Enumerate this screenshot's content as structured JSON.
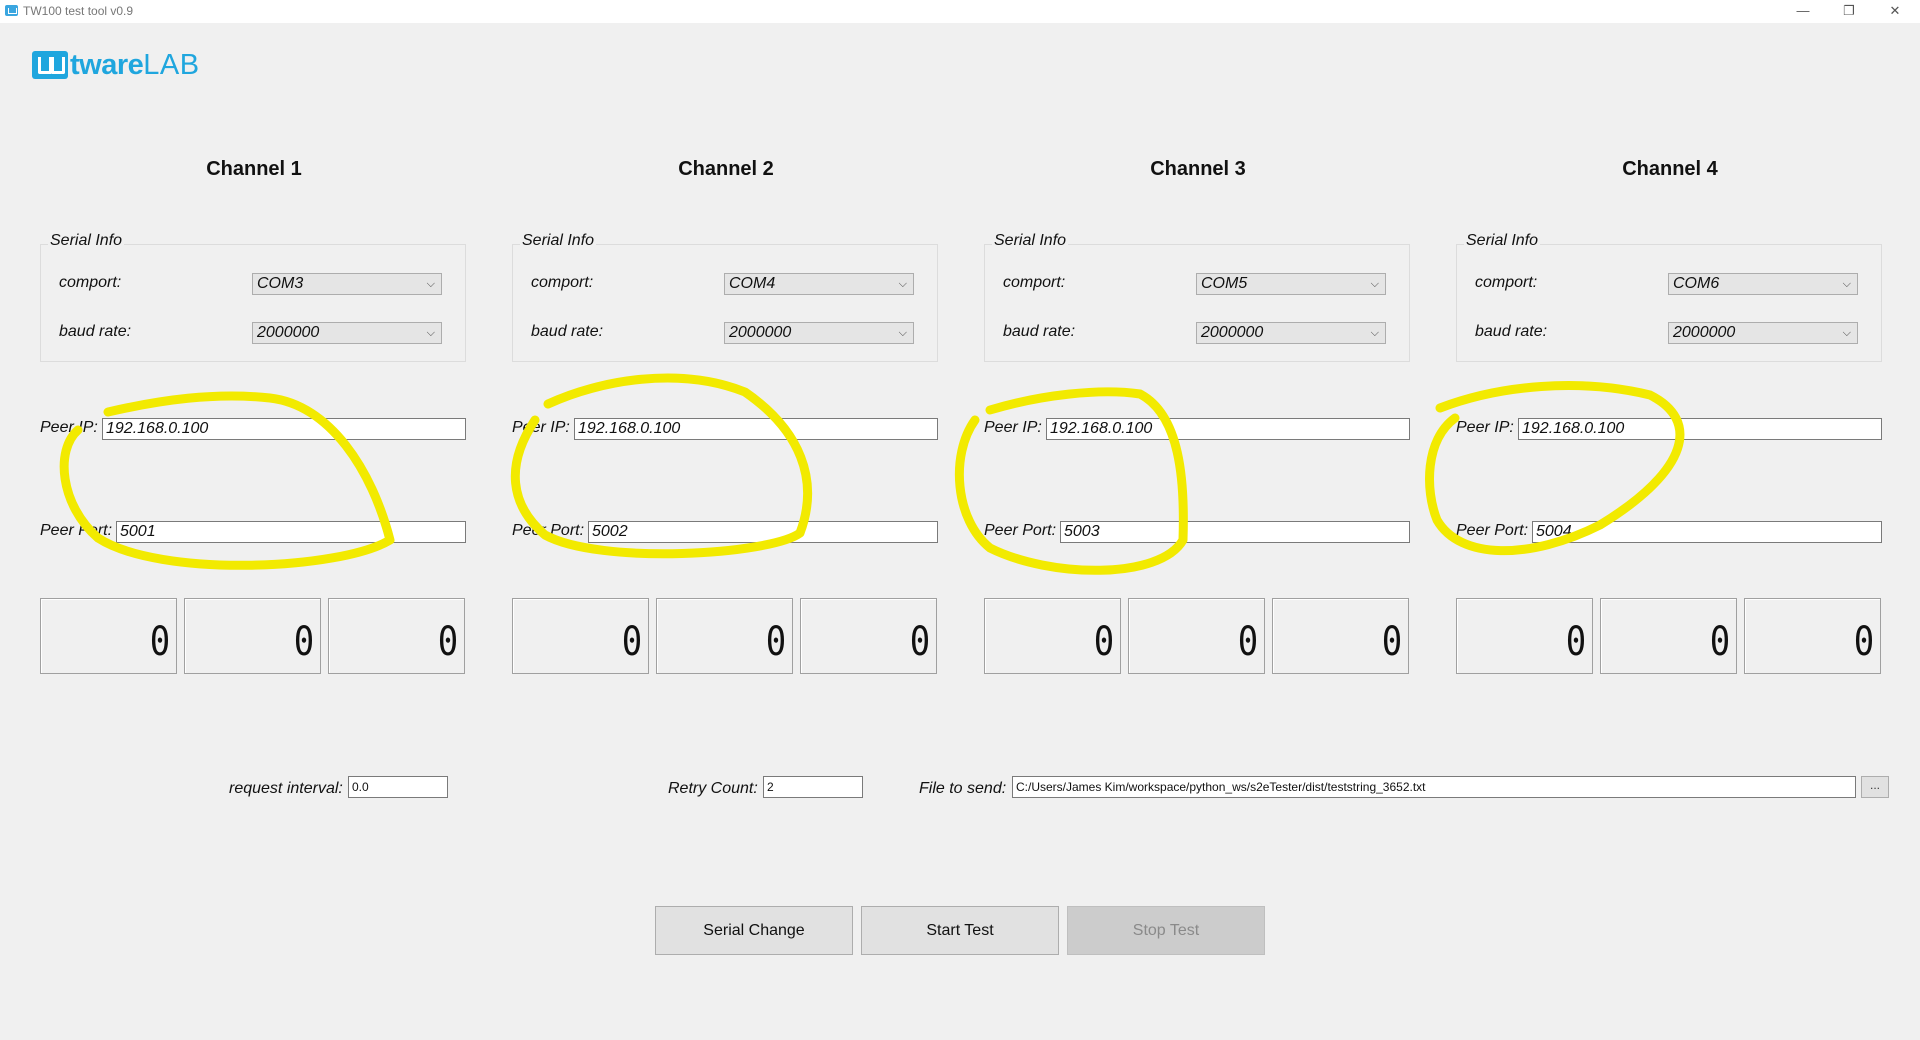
{
  "window": {
    "title": "TW100 test tool v0.9",
    "minimize": "—",
    "restore": "❐",
    "close": "✕"
  },
  "logo": {
    "brand": "tware",
    "suffix": "LAB"
  },
  "channels": [
    {
      "title": "Channel 1",
      "serial_legend": "Serial Info",
      "comport_label": "comport:",
      "comport": "COM3",
      "baud_label": "baud rate:",
      "baud": "2000000",
      "peer_ip_label": "Peer IP:",
      "peer_ip": "192.168.0.100",
      "peer_port_label": "Peer Port:",
      "peer_port": "5001",
      "counters": [
        "0",
        "0",
        "0"
      ]
    },
    {
      "title": "Channel 2",
      "serial_legend": "Serial Info",
      "comport_label": "comport:",
      "comport": "COM4",
      "baud_label": "baud rate:",
      "baud": "2000000",
      "peer_ip_label": "Peer IP:",
      "peer_ip": "192.168.0.100",
      "peer_port_label": "Peer Port:",
      "peer_port": "5002",
      "counters": [
        "0",
        "0",
        "0"
      ]
    },
    {
      "title": "Channel 3",
      "serial_legend": "Serial Info",
      "comport_label": "comport:",
      "comport": "COM5",
      "baud_label": "baud rate:",
      "baud": "2000000",
      "peer_ip_label": "Peer IP:",
      "peer_ip": "192.168.0.100",
      "peer_port_label": "Peer Port:",
      "peer_port": "5003",
      "counters": [
        "0",
        "0",
        "0"
      ]
    },
    {
      "title": "Channel 4",
      "serial_legend": "Serial Info",
      "comport_label": "comport:",
      "comport": "COM6",
      "baud_label": "baud rate:",
      "baud": "2000000",
      "peer_ip_label": "Peer IP:",
      "peer_ip": "192.168.0.100",
      "peer_port_label": "Peer Port:",
      "peer_port": "5004",
      "counters": [
        "0",
        "0",
        "0"
      ]
    }
  ],
  "params": {
    "request_interval_label": "request interval:",
    "request_interval": "0.0",
    "retry_count_label": "Retry Count:",
    "retry_count": "2",
    "file_label": "File to send:",
    "file_path": "C:/Users/James Kim/workspace/python_ws/s2eTester/dist/teststring_3652.txt",
    "browse": "..."
  },
  "buttons": {
    "serial_change": "Serial Change",
    "start_test": "Start Test",
    "stop_test": "Stop Test"
  },
  "colors": {
    "accent": "#1fa6de",
    "highlight": "#f2ea00",
    "background": "#f0f0f0"
  },
  "icons": {
    "combo_arrow": "⌵"
  }
}
